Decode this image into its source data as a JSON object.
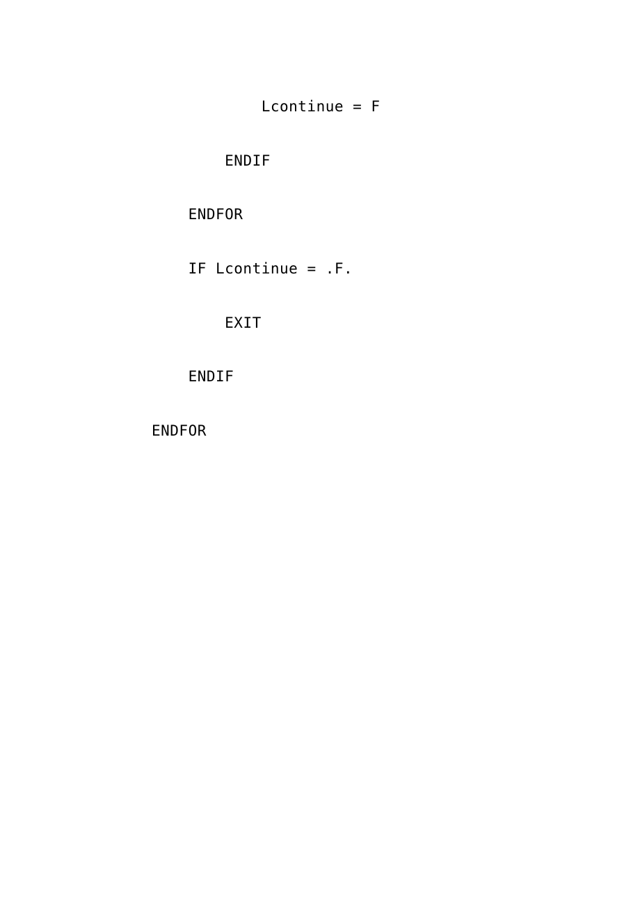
{
  "code": {
    "lines": [
      {
        "indent": "            ",
        "text": "Lcontinue = F"
      },
      {
        "indent": "        ",
        "text": "ENDIF"
      },
      {
        "indent": "    ",
        "text": "ENDFOR"
      },
      {
        "indent": "    ",
        "text": "IF Lcontinue = .F."
      },
      {
        "indent": "        ",
        "text": "EXIT"
      },
      {
        "indent": "    ",
        "text": "ENDIF"
      },
      {
        "indent": "",
        "text": "ENDFOR"
      }
    ]
  }
}
